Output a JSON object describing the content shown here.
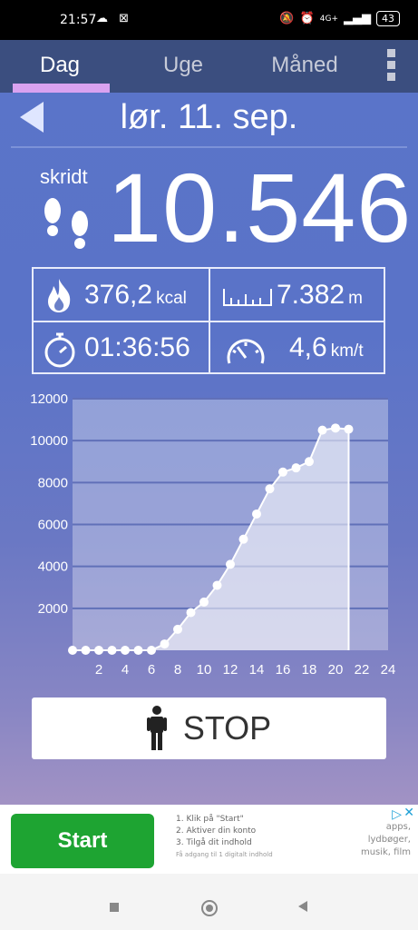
{
  "status_bar": {
    "time": "21:57",
    "network": "4G+",
    "battery": "43"
  },
  "tabs": [
    {
      "label": "Dag",
      "active": true
    },
    {
      "label": "Uge",
      "active": false
    },
    {
      "label": "Måned",
      "active": false
    }
  ],
  "header": {
    "date": "lør. 11. sep."
  },
  "steps": {
    "label": "skridt",
    "value": "10.546"
  },
  "stats": {
    "calories": {
      "value": "376,2",
      "unit": "kcal"
    },
    "distance": {
      "value": "7.382",
      "unit": "m"
    },
    "duration": {
      "value": "01:36:56"
    },
    "speed": {
      "value": "4,6",
      "unit": "km/t"
    }
  },
  "chart_data": {
    "type": "area",
    "x_ticks": [
      "2",
      "4",
      "6",
      "8",
      "10",
      "12",
      "14",
      "16",
      "18",
      "20",
      "22",
      "24"
    ],
    "y_ticks": [
      "12000",
      "10000",
      "8000",
      "6000",
      "4000",
      "2000"
    ],
    "xlim": [
      0,
      24
    ],
    "ylim": [
      0,
      12000
    ],
    "x": [
      0,
      1,
      2,
      3,
      4,
      5,
      6,
      7,
      8,
      9,
      10,
      11,
      12,
      13,
      14,
      15,
      16,
      17,
      18,
      19,
      20,
      21
    ],
    "values": [
      0,
      0,
      0,
      0,
      0,
      0,
      0,
      300,
      1000,
      1800,
      2300,
      3100,
      4100,
      5300,
      6500,
      7700,
      8500,
      8700,
      9000,
      10500,
      10600,
      10546
    ],
    "grid": true,
    "colors": {
      "line": "#ffffff",
      "fill": "rgba(255,255,255,0.55)",
      "plot_bg": "rgba(255,255,255,0.32)",
      "grid": "#6070b8"
    }
  },
  "stop_button": {
    "label": "STOP"
  },
  "ad": {
    "button": "Start",
    "steps": [
      "1. Klik på \"Start\"",
      "2. Aktiver din konto",
      "3. Tilgå dit indhold"
    ],
    "fine_print": "Få adgang til 1 digitalt indhold",
    "right_text": [
      "apps,",
      "lydbøger,",
      "musik, film"
    ]
  },
  "icons": {
    "back": "back-arrow-icon",
    "feet": "footprints-icon",
    "fire": "flame-icon",
    "ruler": "ruler-icon",
    "stopwatch": "stopwatch-icon",
    "speedometer": "speedometer-icon",
    "person": "person-icon"
  }
}
